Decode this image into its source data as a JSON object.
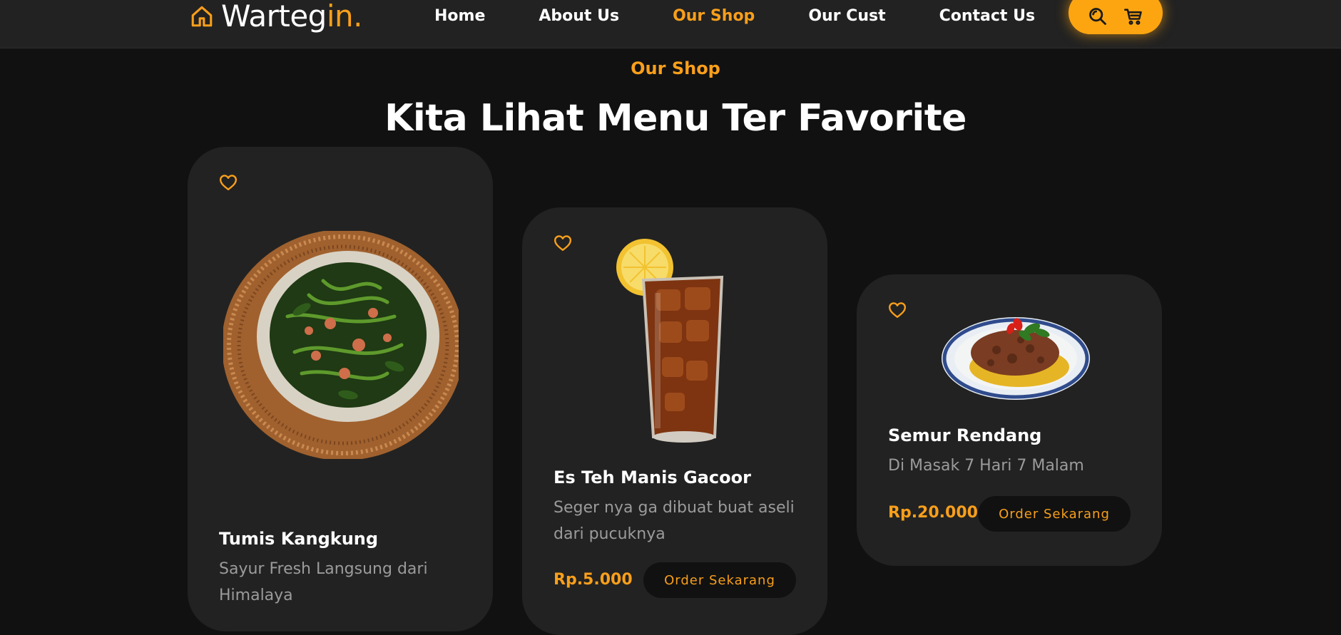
{
  "brand": {
    "name_main": "Warteg",
    "name_accent": "in",
    "name_dot": ".",
    "accent_color": "#f89f1b",
    "logo_icon": "house-icon"
  },
  "nav": {
    "links": [
      {
        "label": "Home",
        "active": false
      },
      {
        "label": "About Us",
        "active": false
      },
      {
        "label": "Our Shop",
        "active": true
      },
      {
        "label": "Our Cust",
        "active": false
      },
      {
        "label": "Contact Us",
        "active": false
      }
    ],
    "actions": [
      {
        "icon": "search-icon"
      },
      {
        "icon": "cart-icon"
      }
    ],
    "actions_bg": "#fda511"
  },
  "section": {
    "tag": "Our Shop",
    "title": "Kita Lihat Menu Ter Favorite"
  },
  "products": [
    {
      "name": "Tumis Kangkung",
      "description": "Sayur Fresh Langsung dari Himalaya",
      "price": "",
      "order_label": "",
      "icon": "heart-icon"
    },
    {
      "name": "Es Teh Manis Gacoor",
      "description": "Seger nya ga dibuat buat aseli dari pucuknya",
      "price": "Rp.5.000",
      "order_label": "Order Sekarang",
      "icon": "heart-icon"
    },
    {
      "name": "Semur Rendang",
      "description": "Di Masak 7 Hari 7 Malam",
      "price": "Rp.20.000",
      "order_label": "Order Sekarang",
      "icon": "heart-icon"
    }
  ],
  "colors": {
    "background": "#111111",
    "card": "#222222",
    "muted_text": "#9b9b9b"
  }
}
